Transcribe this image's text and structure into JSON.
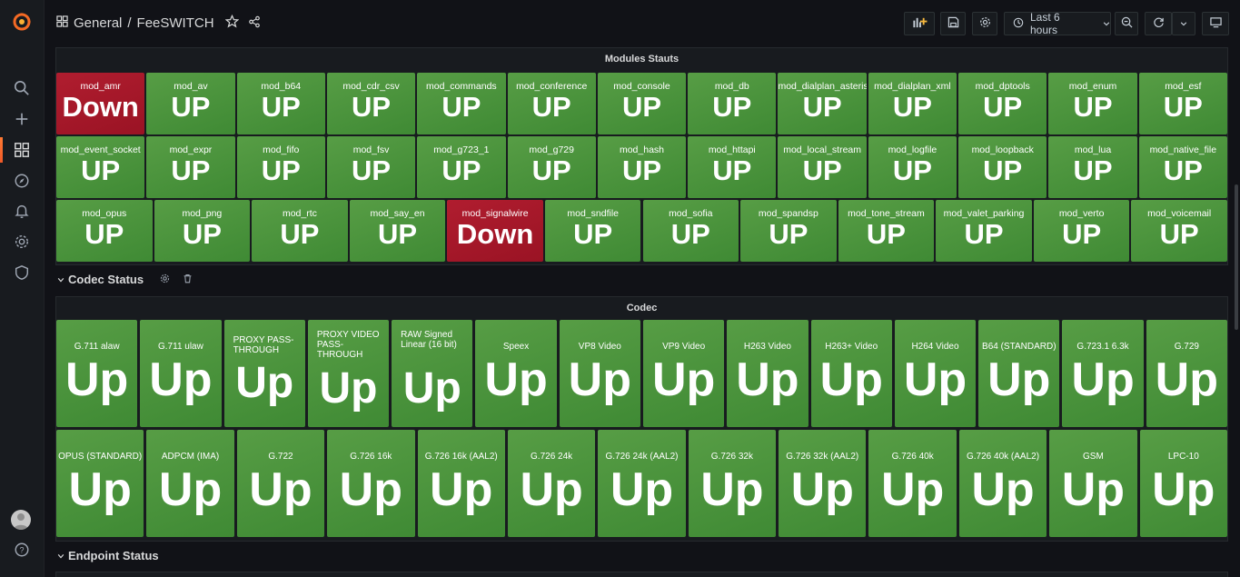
{
  "breadcrumb": {
    "folder": "General",
    "separator": "/",
    "dashboard": "FeeSWITCH"
  },
  "time_picker": {
    "label": "Last 6 hours"
  },
  "modules_panel": {
    "title": "Modules Stauts",
    "rows": [
      [
        {
          "name": "mod_amr",
          "value": "Down",
          "status": "down"
        },
        {
          "name": "mod_av",
          "value": "UP",
          "status": "up"
        },
        {
          "name": "mod_b64",
          "value": "UP",
          "status": "up"
        },
        {
          "name": "mod_cdr_csv",
          "value": "UP",
          "status": "up"
        },
        {
          "name": "mod_commands",
          "value": "UP",
          "status": "up"
        },
        {
          "name": "mod_conference",
          "value": "UP",
          "status": "up"
        },
        {
          "name": "mod_console",
          "value": "UP",
          "status": "up"
        },
        {
          "name": "mod_db",
          "value": "UP",
          "status": "up"
        },
        {
          "name": "mod_dialplan_asterisk",
          "value": "UP",
          "status": "up"
        },
        {
          "name": "mod_dialplan_xml",
          "value": "UP",
          "status": "up"
        },
        {
          "name": "mod_dptools",
          "value": "UP",
          "status": "up"
        },
        {
          "name": "mod_enum",
          "value": "UP",
          "status": "up"
        },
        {
          "name": "mod_esf",
          "value": "UP",
          "status": "up"
        }
      ],
      [
        {
          "name": "mod_event_socket",
          "value": "UP",
          "status": "up"
        },
        {
          "name": "mod_expr",
          "value": "UP",
          "status": "up"
        },
        {
          "name": "mod_fifo",
          "value": "UP",
          "status": "up"
        },
        {
          "name": "mod_fsv",
          "value": "UP",
          "status": "up"
        },
        {
          "name": "mod_g723_1",
          "value": "UP",
          "status": "up"
        },
        {
          "name": "mod_g729",
          "value": "UP",
          "status": "up"
        },
        {
          "name": "mod_hash",
          "value": "UP",
          "status": "up"
        },
        {
          "name": "mod_httapi",
          "value": "UP",
          "status": "up"
        },
        {
          "name": "mod_local_stream",
          "value": "UP",
          "status": "up"
        },
        {
          "name": "mod_logfile",
          "value": "UP",
          "status": "up"
        },
        {
          "name": "mod_loopback",
          "value": "UP",
          "status": "up"
        },
        {
          "name": "mod_lua",
          "value": "UP",
          "status": "up"
        },
        {
          "name": "mod_native_file",
          "value": "UP",
          "status": "up"
        }
      ],
      [
        {
          "name": "mod_opus",
          "value": "UP",
          "status": "up"
        },
        {
          "name": "mod_png",
          "value": "UP",
          "status": "up"
        },
        {
          "name": "mod_rtc",
          "value": "UP",
          "status": "up"
        },
        {
          "name": "mod_say_en",
          "value": "UP",
          "status": "up"
        },
        {
          "name": "mod_signalwire",
          "value": "Down",
          "status": "down"
        },
        {
          "name": "mod_sndfile",
          "value": "UP",
          "status": "up"
        },
        {
          "name": "mod_sofia",
          "value": "UP",
          "status": "up"
        },
        {
          "name": "mod_spandsp",
          "value": "UP",
          "status": "up"
        },
        {
          "name": "mod_tone_stream",
          "value": "UP",
          "status": "up"
        },
        {
          "name": "mod_valet_parking",
          "value": "UP",
          "status": "up"
        },
        {
          "name": "mod_verto",
          "value": "UP",
          "status": "up"
        },
        {
          "name": "mod_voicemail",
          "value": "UP",
          "status": "up"
        }
      ]
    ]
  },
  "codec_row": {
    "title": "Codec Status"
  },
  "codec_panel": {
    "title": "Codec",
    "rows": [
      [
        {
          "name": "G.711 alaw",
          "value": "Up"
        },
        {
          "name": "G.711 ulaw",
          "value": "Up"
        },
        {
          "name": "PROXY PASS-THROUGH",
          "value": "Up"
        },
        {
          "name": "PROXY VIDEO PASS-THROUGH",
          "value": "Up"
        },
        {
          "name": "RAW Signed Linear (16 bit)",
          "value": "Up"
        },
        {
          "name": "Speex",
          "value": "Up"
        },
        {
          "name": "VP8 Video",
          "value": "Up"
        },
        {
          "name": "VP9 Video",
          "value": "Up"
        },
        {
          "name": "H263 Video",
          "value": "Up"
        },
        {
          "name": "H263+ Video",
          "value": "Up"
        },
        {
          "name": "H264 Video",
          "value": "Up"
        },
        {
          "name": "B64 (STANDARD)",
          "value": "Up"
        },
        {
          "name": "G.723.1 6.3k",
          "value": "Up"
        },
        {
          "name": "G.729",
          "value": "Up"
        }
      ],
      [
        {
          "name": "OPUS (STANDARD)",
          "value": "Up"
        },
        {
          "name": "ADPCM (IMA)",
          "value": "Up"
        },
        {
          "name": "G.722",
          "value": "Up"
        },
        {
          "name": "G.726 16k",
          "value": "Up"
        },
        {
          "name": "G.726 16k (AAL2)",
          "value": "Up"
        },
        {
          "name": "G.726 24k",
          "value": "Up"
        },
        {
          "name": "G.726 24k (AAL2)",
          "value": "Up"
        },
        {
          "name": "G.726 32k",
          "value": "Up"
        },
        {
          "name": "G.726 32k (AAL2)",
          "value": "Up"
        },
        {
          "name": "G.726 40k",
          "value": "Up"
        },
        {
          "name": "G.726 40k (AAL2)",
          "value": "Up"
        },
        {
          "name": "GSM",
          "value": "Up"
        },
        {
          "name": "LPC-10",
          "value": "Up"
        }
      ]
    ]
  },
  "endpoint_row": {
    "title": "Endpoint Status"
  },
  "colors": {
    "up": "#4a9a3c",
    "down": "#a81a2c",
    "accent": "#f05a28",
    "background": "#111217",
    "panel": "#181b1f"
  },
  "icons": {
    "sidenav": [
      "grafana-logo-icon",
      "search-icon",
      "plus-icon",
      "dashboards-icon",
      "compass-icon",
      "bell-icon",
      "gear-icon",
      "shield-icon",
      "user-avatar",
      "help-icon"
    ],
    "toolbar": [
      "add-panel-icon",
      "save-icon",
      "settings-icon",
      "clock-icon",
      "zoom-out-icon",
      "refresh-icon",
      "chevron-down-icon",
      "tv-icon"
    ]
  }
}
